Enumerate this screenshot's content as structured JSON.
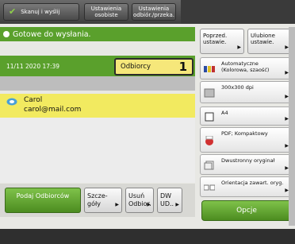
{
  "topbar": {
    "scan_label": "Skanuj i wyślij",
    "pref_label": "Ustawienia osobiste",
    "recv_label": "Ustawienia odbiór./przeka."
  },
  "status": {
    "text": "Gotowe do wysłania."
  },
  "info": {
    "datetime": "11/11 2020 17:39",
    "recipients_label": "Odbiorcy",
    "recipients_count": "1"
  },
  "recipient": {
    "name": "Carol",
    "email": "carol@mail.com"
  },
  "bottom": {
    "specify_label": "Podaj Odbiorców",
    "details_label": "Szcze-góły",
    "remove_label": "Usuń Odbior.",
    "cc_label": "DW UD.."
  },
  "settings": {
    "prev_label": "Poprzed. ustawie.",
    "fav_label": "Ulubione ustawie.",
    "color_label": "Automatyczne (Kolorowa, szaość)",
    "resolution_label": "300x300 dpi",
    "size_label": "A4",
    "format_label": "PDF; Kompaktowy",
    "duplex_label": "Dwustronny oryginał",
    "orientation_label": "Orientacja zawart. oryg.",
    "options_label": "Opcje"
  }
}
